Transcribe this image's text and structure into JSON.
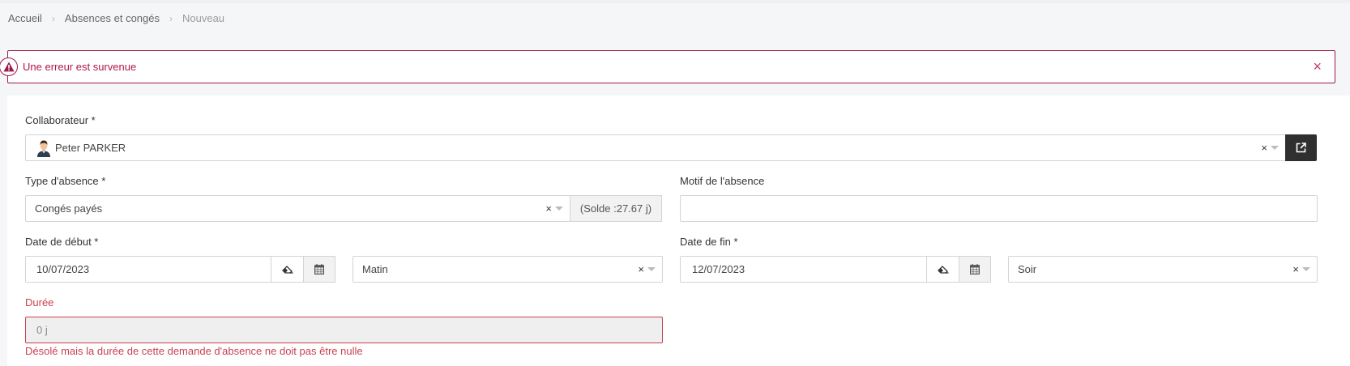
{
  "breadcrumb": {
    "home": "Accueil",
    "section": "Absences et congés",
    "current": "Nouveau",
    "separator": "›"
  },
  "alert": {
    "message": "Une erreur est survenue",
    "close": "×",
    "icon": "warning-triangle-icon",
    "color": "#9c1a4a"
  },
  "form": {
    "collaborator": {
      "label": "Collaborateur *",
      "value": "Peter PARKER",
      "clear": "×",
      "open_icon": "external-link-icon"
    },
    "absence_type": {
      "label": "Type d'absence *",
      "value": "Congés payés",
      "clear": "×",
      "balance": "(Solde :27.67 j)"
    },
    "reason": {
      "label": "Motif de l'absence",
      "value": ""
    },
    "start_date": {
      "label": "Date de début *",
      "value": "10/07/2023",
      "period": "Matin",
      "clear": "×",
      "eraser_icon": "eraser-icon",
      "calendar_icon": "calendar-icon"
    },
    "end_date": {
      "label": "Date de fin *",
      "value": "12/07/2023",
      "period": "Soir",
      "clear": "×",
      "eraser_icon": "eraser-icon",
      "calendar_icon": "calendar-icon"
    },
    "duration": {
      "label": "Durée",
      "value": "0 j",
      "error": "Désolé mais la durée de cette demande d'absence ne doit pas être nulle",
      "error_color": "#c9404f"
    }
  }
}
